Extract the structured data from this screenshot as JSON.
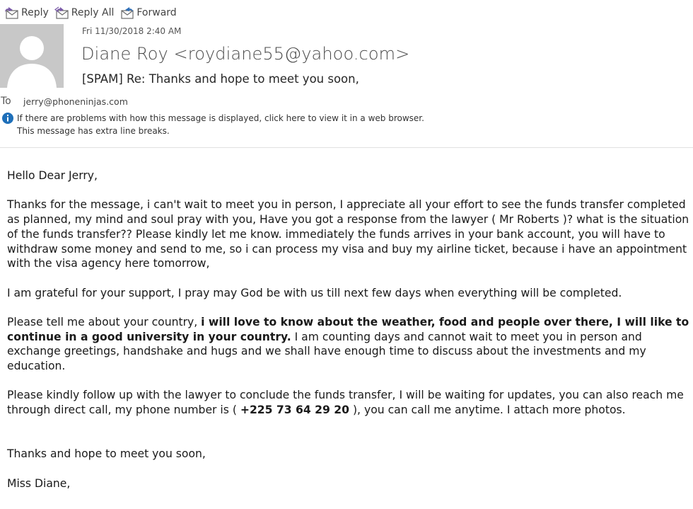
{
  "toolbar": {
    "reply_label": "Reply",
    "reply_all_label": "Reply All",
    "forward_label": "Forward"
  },
  "header": {
    "date": "Fri 11/30/2018 2:40 AM",
    "from": "Diane Roy <roydiane55@yahoo.com>",
    "subject": "[SPAM] Re: Thanks and hope to meet you soon,",
    "to_label": "To",
    "to_address": "jerry@phoneninjas.com",
    "info_line1": "If there are problems with how this message is displayed, click here to view it in a web browser.",
    "info_line2": "This message has extra line breaks."
  },
  "body": {
    "greeting": "Hello Dear Jerry,",
    "para1": "Thanks for the message, i can't wait to meet you in person, I appreciate all your effort to see the funds transfer completed as planned, my mind and soul pray with you, Have you got a response from the lawyer ( Mr Roberts )? what is the situation of the funds transfer?? Please kindly let me know. immediately the funds arrives in your bank account, you will have to withdraw some money and send to me, so i can process my visa and buy my airline ticket, because i have an appointment with the visa agency here tomorrow,",
    "para2": "I am grateful for your support, I pray may God be with us till next few days when everything will be completed.",
    "para3_a": "Please tell me about your country, ",
    "para3_bold": "i will love to know about the weather, food and people over there, I will like to continue in a good university in your country.",
    "para3_b": "  I am counting days and cannot wait to meet you in person and exchange greetings, handshake and hugs and we shall have enough time to discuss about the investments and my education.",
    "para4_a": "Please kindly follow up with the lawyer to conclude the funds transfer, I will be waiting for updates,  you can also reach me through direct call, my phone number is ( ",
    "para4_phone": "+225 73 64 29 20",
    "para4_b": " ), you can call me anytime. I attach more photos.",
    "closing": "Thanks and hope to meet you soon,",
    "signature": "Miss Diane,"
  },
  "colors": {
    "avatar_bg": "#c8c8c8",
    "info_icon": "#1e6fb9",
    "toolbar_icon": "#7a5aa8"
  },
  "icons": {
    "reply": "reply-icon",
    "reply_all": "reply-all-icon",
    "forward": "forward-icon",
    "info": "info-icon",
    "avatar": "person-silhouette"
  }
}
